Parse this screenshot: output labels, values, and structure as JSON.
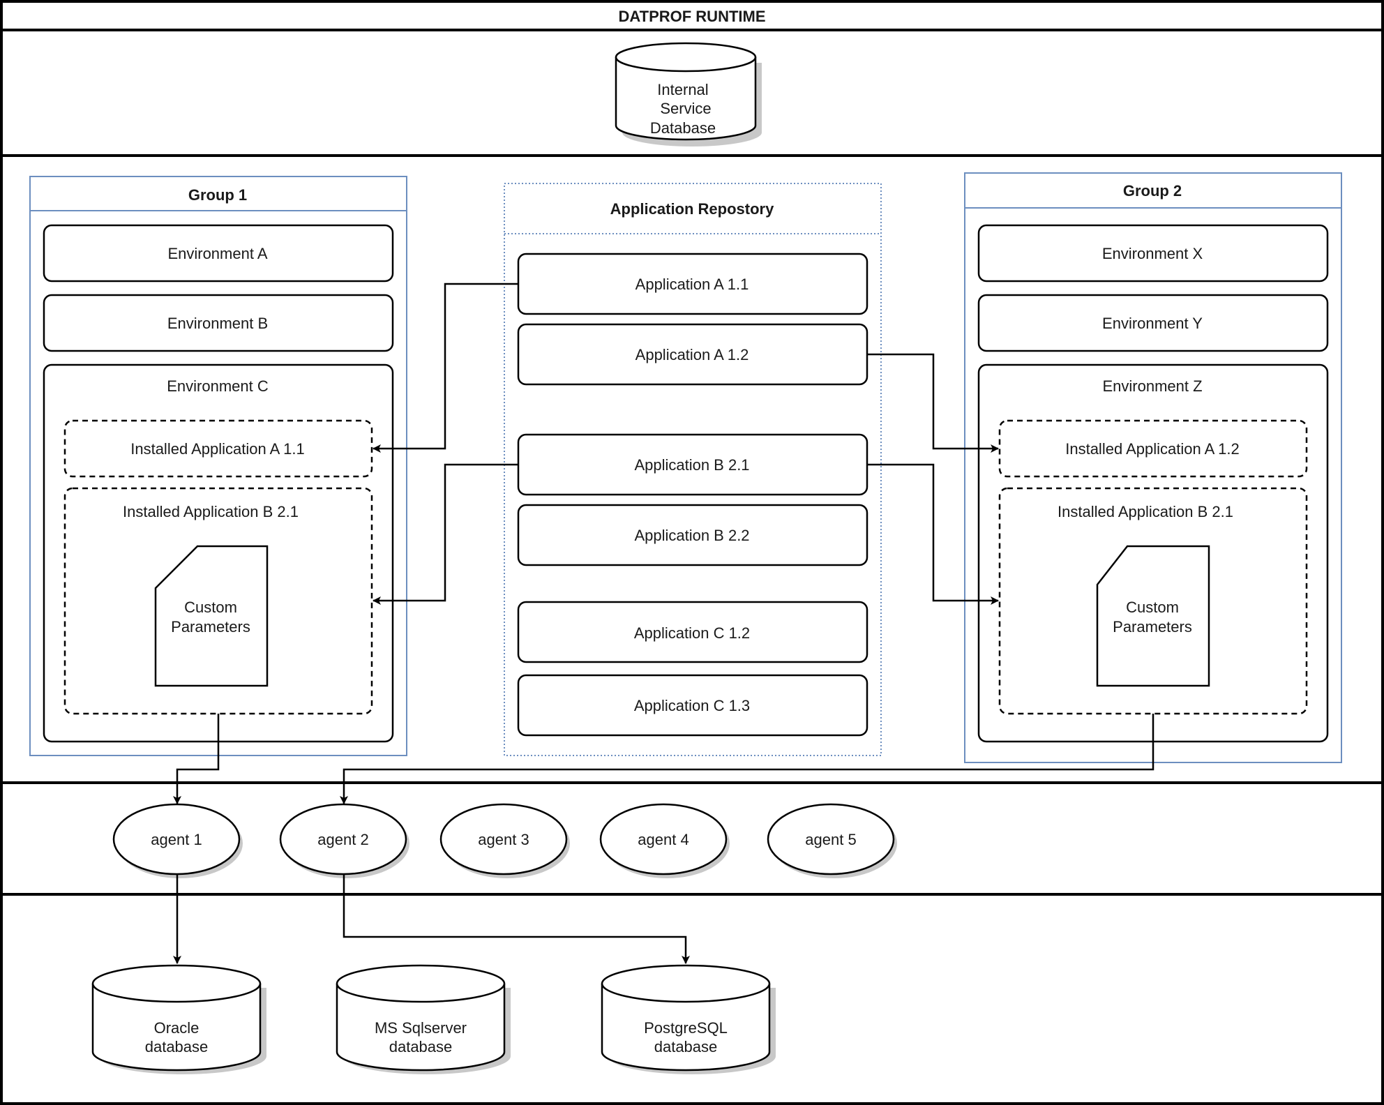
{
  "title": "DATPROF RUNTIME",
  "internal_db": {
    "lines": [
      "Internal",
      "Service",
      "Database"
    ]
  },
  "group1": {
    "title": "Group 1",
    "environments": [
      "Environment A",
      "Environment B",
      "Environment C"
    ],
    "installed": [
      "Installed Application A 1.1",
      "Installed Application B 2.1"
    ],
    "params": [
      "Custom",
      "Parameters"
    ]
  },
  "repository": {
    "title": "Application Repostory",
    "apps": [
      "Application A 1.1",
      "Application A 1.2",
      "Application B 2.1",
      "Application B 2.2",
      "Application C 1.2",
      "Application C 1.3"
    ]
  },
  "group2": {
    "title": "Group 2",
    "environments": [
      "Environment X",
      "Environment Y",
      "Environment Z"
    ],
    "installed": [
      "Installed Application A 1.2",
      "Installed Application B 2.1"
    ],
    "params": [
      "Custom",
      "Parameters"
    ]
  },
  "agents": [
    "agent 1",
    "agent 2",
    "agent 3",
    "agent 4",
    "agent 5"
  ],
  "databases": [
    {
      "lines": [
        "Oracle",
        "database"
      ]
    },
    {
      "lines": [
        "MS Sqlserver",
        "database"
      ]
    },
    {
      "lines": [
        "PostgreSQL",
        "database"
      ]
    }
  ],
  "connections": [
    {
      "from": "Application A 1.1",
      "to": "Group 1 / Installed Application A 1.1"
    },
    {
      "from": "Application B 2.1",
      "to": "Group 1 / Installed Application B 2.1"
    },
    {
      "from": "Application A 1.2",
      "to": "Group 2 / Installed Application A 1.2"
    },
    {
      "from": "Application B 2.1",
      "to": "Group 2 / Installed Application B 2.1"
    },
    {
      "from": "Group 1 / Installed Application B 2.1",
      "to": "agent 1"
    },
    {
      "from": "Group 2 / Installed Application B 2.1",
      "to": "agent 2"
    },
    {
      "from": "agent 1",
      "to": "Oracle database"
    },
    {
      "from": "agent 2",
      "to": "PostgreSQL database"
    }
  ]
}
